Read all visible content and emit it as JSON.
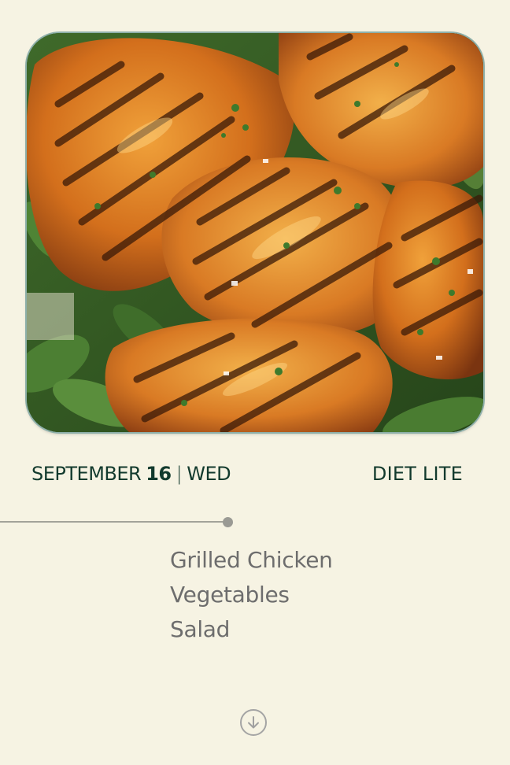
{
  "hero_image": {
    "icon": "grilled-chicken-photo"
  },
  "date": {
    "month": "SEPTEMBER",
    "day": "16",
    "separator": "|",
    "weekday": "WED"
  },
  "plan_name": "DIET LITE",
  "menu": {
    "items": [
      {
        "label": "Grilled Chicken"
      },
      {
        "label": "Vegetables"
      },
      {
        "label": "Salad"
      }
    ]
  },
  "scroll_button": {
    "icon": "arrow-down-circle-icon"
  },
  "colors": {
    "background": "#f6f3e3",
    "primary_text": "#123a2d",
    "menu_text": "#6d6d6d",
    "timeline": "#a3a39a"
  }
}
